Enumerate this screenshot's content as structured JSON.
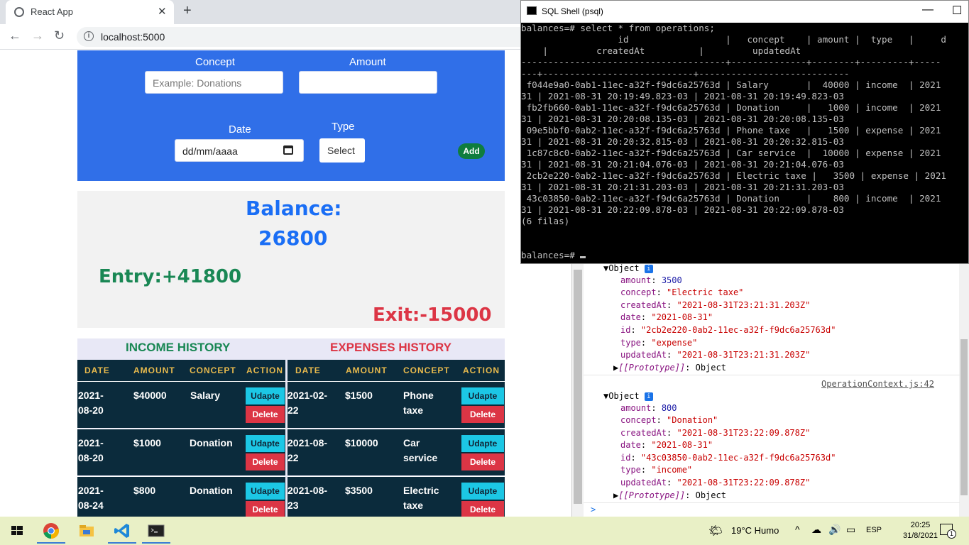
{
  "browser": {
    "tab_title": "React App",
    "tab_close": "✕",
    "new_tab": "+",
    "url": "localhost:5000",
    "back": "←",
    "forward": "→",
    "reload": "↻",
    "info": "i"
  },
  "form": {
    "concept_label": "Concept",
    "concept_placeholder": "Example: Donations",
    "amount_label": "Amount",
    "amount_value": "",
    "date_label": "Date",
    "date_placeholder": "dd/mm/aaaa",
    "type_label": "Type",
    "type_selected": "Select",
    "add_label": "Add"
  },
  "balance": {
    "title": "Balance:",
    "value": "26800",
    "entry": "Entry:+41800",
    "exit": "Exit:-15000"
  },
  "income_history": {
    "title": "INCOME HISTORY",
    "columns": [
      "DATE",
      "AMOUNT",
      "CONCEPT",
      "ACTION"
    ],
    "rows": [
      {
        "date_l1": "2021-",
        "date_l2": "08-20",
        "amount": "$40000",
        "concept_l1": "Salary",
        "concept_l2": ""
      },
      {
        "date_l1": "2021-",
        "date_l2": "08-20",
        "amount": "$1000",
        "concept_l1": "Donation",
        "concept_l2": ""
      },
      {
        "date_l1": "2021-",
        "date_l2": "08-24",
        "amount": "$800",
        "concept_l1": "Donation",
        "concept_l2": ""
      }
    ]
  },
  "expenses_history": {
    "title": "EXPENSES HISTORY",
    "columns": [
      "DATE",
      "AMOUNT",
      "CONCEPT",
      "ACTION"
    ],
    "rows": [
      {
        "date_l1": "2021-02-",
        "date_l2": "22",
        "amount": "$1500",
        "concept_l1": "Phone",
        "concept_l2": "taxe"
      },
      {
        "date_l1": "2021-08-",
        "date_l2": "22",
        "amount": "$10000",
        "concept_l1": "Car",
        "concept_l2": "service"
      },
      {
        "date_l1": "2021-08-",
        "date_l2": "23",
        "amount": "$3500",
        "concept_l1": "Electric",
        "concept_l2": "taxe"
      }
    ]
  },
  "actions": {
    "update": "Udapte",
    "delete": "Delete"
  },
  "sql_shell": {
    "title": "SQL Shell (psql)",
    "minimize": "—",
    "maximize": "☐",
    "lines": [
      "balances=# select * from operations;",
      "                  id                  |   concept    | amount |  type   |     d",
      "    |         createdAt          |         updatedAt",
      "--------------------------------------+--------------+--------+---------+-----",
      "---+----------------------------+----------------------------",
      " f044e9a0-0ab1-11ec-a32f-f9dc6a25763d | Salary       |  40000 | income  | 2021",
      "31 | 2021-08-31 20:19:49.823-03 | 2021-08-31 20:19:49.823-03",
      " fb2fb660-0ab1-11ec-a32f-f9dc6a25763d | Donation     |   1000 | income  | 2021",
      "31 | 2021-08-31 20:20:08.135-03 | 2021-08-31 20:20:08.135-03",
      " 09e5bbf0-0ab2-11ec-a32f-f9dc6a25763d | Phone taxe   |   1500 | expense | 2021",
      "31 | 2021-08-31 20:20:32.815-03 | 2021-08-31 20:20:32.815-03",
      " 1c87c8c0-0ab2-11ec-a32f-f9dc6a25763d | Car service  |  10000 | expense | 2021",
      "31 | 2021-08-31 20:21:04.076-03 | 2021-08-31 20:21:04.076-03",
      " 2cb2e220-0ab2-11ec-a32f-f9dc6a25763d | Electric taxe |   3500 | expense | 2021",
      "31 | 2021-08-31 20:21:31.203-03 | 2021-08-31 20:21:31.203-03",
      " 43c03850-0ab2-11ec-a32f-f9dc6a25763d | Donation     |    800 | income  | 2021",
      "31 | 2021-08-31 20:22:09.878-03 | 2021-08-31 20:22:09.878-03",
      "(6 filas)",
      "",
      ""
    ],
    "prompt": "balances=# "
  },
  "console": {
    "obj1": {
      "label": "Object",
      "amount": "3500",
      "concept": "\"Electric taxe\"",
      "createdAt": "\"2021-08-31T23:21:31.203Z\"",
      "date": "\"2021-08-31\"",
      "id": "\"2cb2e220-0ab2-11ec-a32f-f9dc6a25763d\"",
      "type": "\"expense\"",
      "updatedAt": "\"2021-08-31T23:21:31.203Z\"",
      "prototype": "[[Prototype]]",
      "prototype_value": ": Object"
    },
    "source_link": "OperationContext.js:42",
    "obj2": {
      "label": "Object",
      "amount": "800",
      "concept": "\"Donation\"",
      "createdAt": "\"2021-08-31T23:22:09.878Z\"",
      "date": "\"2021-08-31\"",
      "id": "\"43c03850-0ab2-11ec-a32f-f9dc6a25763d\"",
      "type": "\"income\"",
      "updatedAt": "\"2021-08-31T23:22:09.878Z\"",
      "prototype": "[[Prototype]]",
      "prototype_value": ": Object"
    },
    "prompt": ">"
  },
  "taskbar": {
    "weather": "19°C  Humo",
    "lang": "ESP",
    "time": "20:25",
    "date": "31/8/2021",
    "notifications": "1"
  },
  "colors": {
    "form_bg": "#306fe8",
    "balance_blue": "#1a6ef5",
    "entry_green": "#198754",
    "exit_red": "#dc3545",
    "table_bg": "#0b2b3c",
    "header_gold": "#e7b94d"
  }
}
